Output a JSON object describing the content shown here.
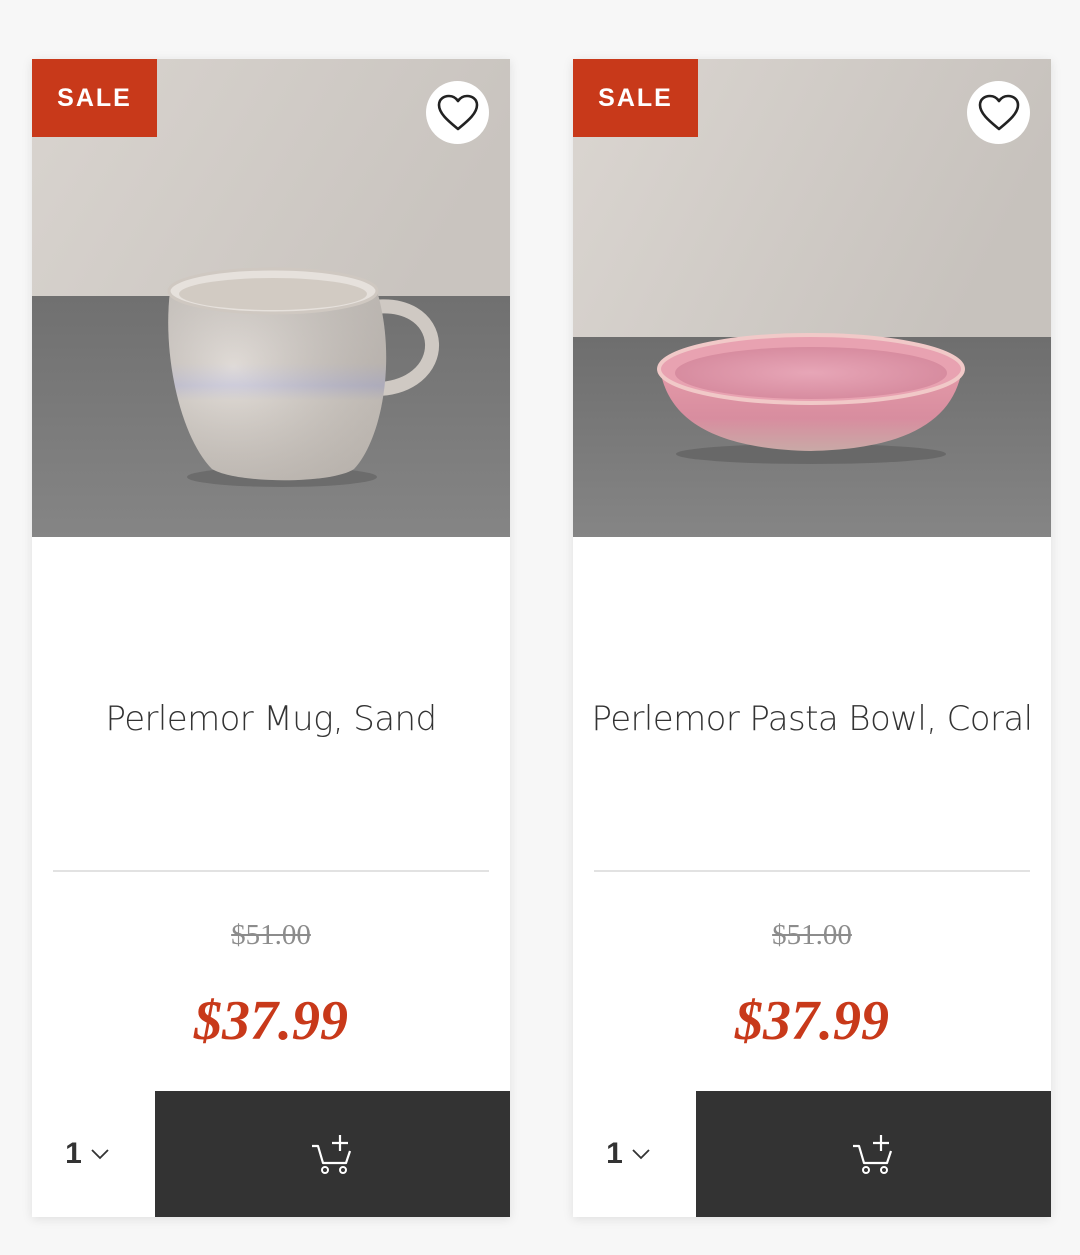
{
  "products": [
    {
      "badge": "SALE",
      "name": "Perlemor Mug, Sand",
      "old_price": "$51.00",
      "price": "$37.99",
      "quantity": "1",
      "image": "mug-photo"
    },
    {
      "badge": "SALE",
      "name": "Perlemor Pasta Bowl, Coral",
      "old_price": "$51.00",
      "price": "$37.99",
      "quantity": "1",
      "image": "bowl-photo"
    }
  ],
  "icons": {
    "wishlist": "heart-outline-icon",
    "quantity_dropdown": "chevron-down-icon",
    "add_to_cart": "cart-plus-icon"
  },
  "colors": {
    "sale_accent": "#c8391a",
    "cart_button": "#333333"
  }
}
